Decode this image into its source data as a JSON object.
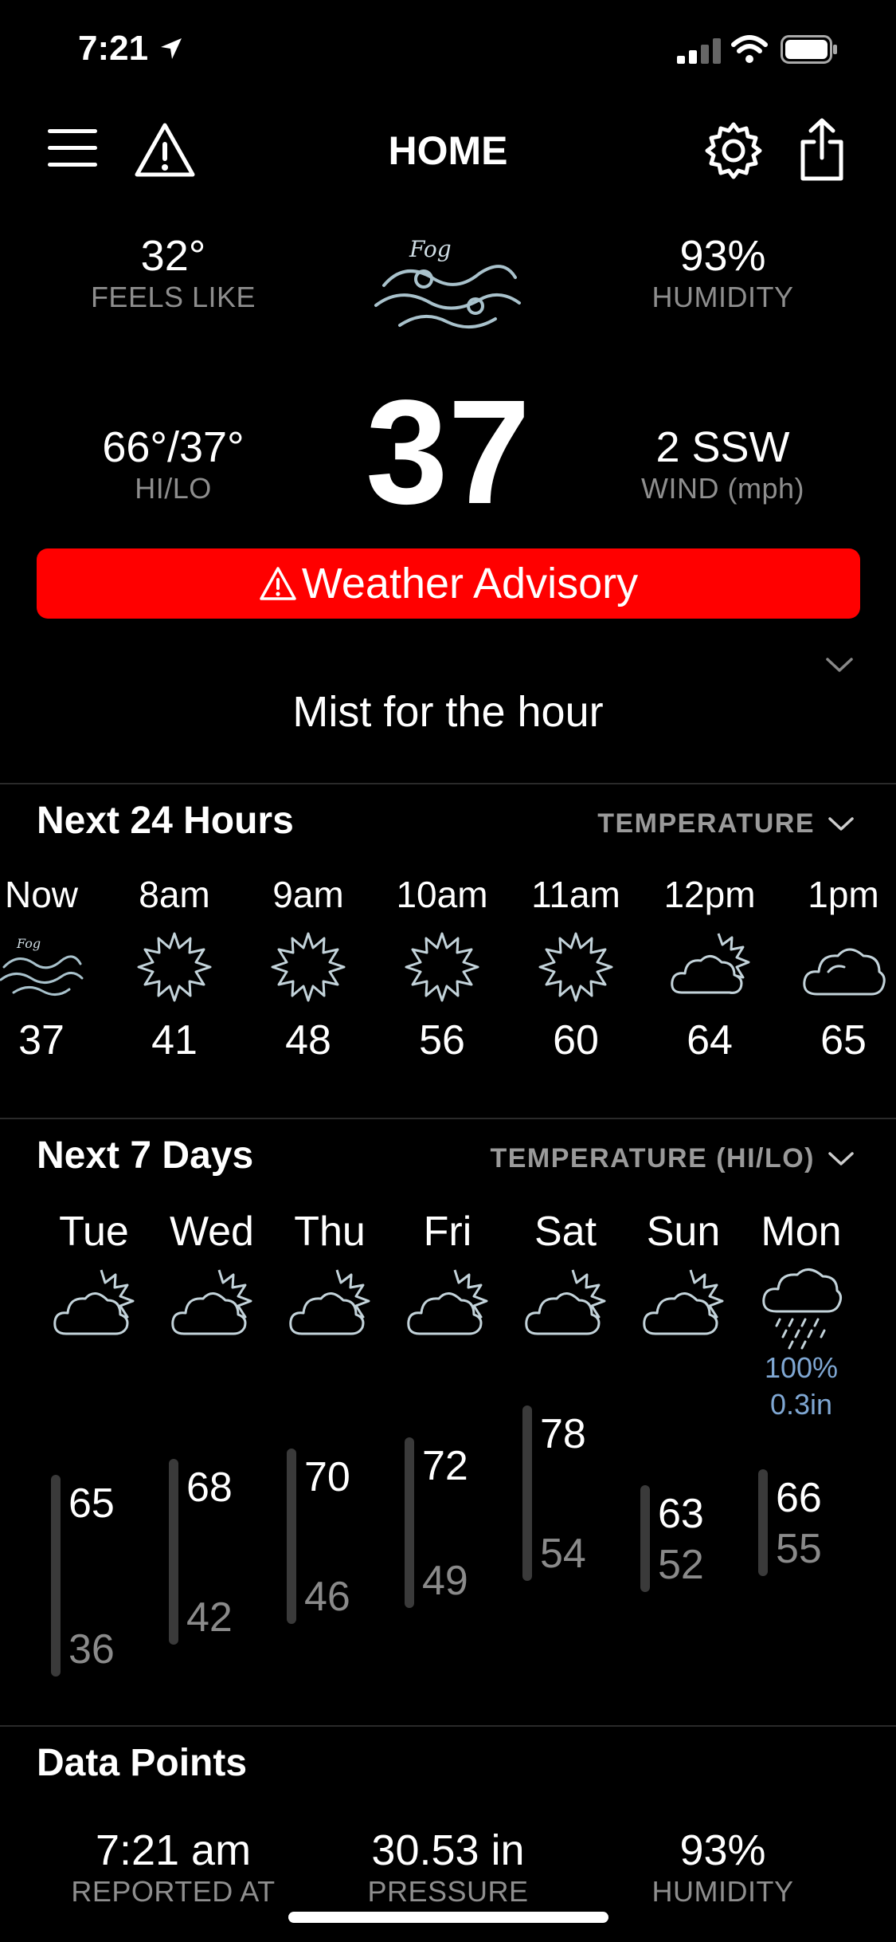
{
  "status_bar": {
    "time": "7:21"
  },
  "header": {
    "title": "HOME"
  },
  "current": {
    "feels_like_value": "32°",
    "feels_like_label": "FEELS LIKE",
    "humidity_value": "93%",
    "humidity_label": "HUMIDITY",
    "hilo_value": "66°/37°",
    "hilo_label": "HI/LO",
    "temperature": "37",
    "wind_value": "2 SSW",
    "wind_label": "WIND (mph)",
    "condition_icon_text": "Fog"
  },
  "advisory": {
    "label": "Weather Advisory",
    "color": "#ff0000"
  },
  "summary": {
    "text": "Mist for the hour"
  },
  "next24": {
    "title": "Next 24 Hours",
    "selector": "TEMPERATURE",
    "hours": [
      {
        "time": "Now",
        "icon": "fog-icon",
        "temp": "37"
      },
      {
        "time": "8am",
        "icon": "sun-icon",
        "temp": "41"
      },
      {
        "time": "9am",
        "icon": "sun-icon",
        "temp": "48"
      },
      {
        "time": "10am",
        "icon": "sun-icon",
        "temp": "56"
      },
      {
        "time": "11am",
        "icon": "sun-icon",
        "temp": "60"
      },
      {
        "time": "12pm",
        "icon": "partly-cloudy-icon",
        "temp": "64"
      },
      {
        "time": "1pm",
        "icon": "cloudy-icon",
        "temp": "65"
      }
    ]
  },
  "next7": {
    "title": "Next 7 Days",
    "selector": "TEMPERATURE (HI/LO)",
    "days": [
      {
        "name": "Tue",
        "icon": "partly-cloudy-icon",
        "hi": "65",
        "lo": "36"
      },
      {
        "name": "Wed",
        "icon": "partly-cloudy-icon",
        "hi": "68",
        "lo": "42"
      },
      {
        "name": "Thu",
        "icon": "partly-cloudy-icon",
        "hi": "70",
        "lo": "46"
      },
      {
        "name": "Fri",
        "icon": "partly-cloudy-icon",
        "hi": "72",
        "lo": "49"
      },
      {
        "name": "Sat",
        "icon": "partly-cloudy-icon",
        "hi": "78",
        "lo": "54"
      },
      {
        "name": "Sun",
        "icon": "partly-cloudy-icon",
        "hi": "63",
        "lo": "52"
      },
      {
        "name": "Mon",
        "icon": "rain-icon",
        "hi": "66",
        "lo": "55",
        "precip_chance": "100%",
        "precip_amount": "0.3in"
      }
    ]
  },
  "data_points": {
    "title": "Data Points",
    "reported_value": "7:21 am",
    "reported_label": "REPORTED AT",
    "pressure_value": "30.53 in",
    "pressure_label": "PRESSURE",
    "humidity_value": "93%",
    "humidity_label": "HUMIDITY"
  }
}
